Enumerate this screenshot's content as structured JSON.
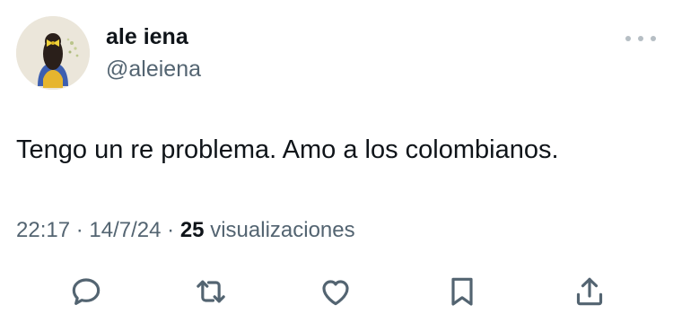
{
  "author": {
    "display_name": "ale iena",
    "handle": "@aleiena",
    "avatar_icon": "profile-photo-girl-with-yellow-bow"
  },
  "tweet": {
    "text": "Tengo un re problema. Amo a los colombianos."
  },
  "meta": {
    "time": "22:17",
    "date": "14/7/24",
    "separator": "·",
    "views_count": "25",
    "views_label": "visualizaciones"
  },
  "actions": [
    {
      "icon": "reply-icon"
    },
    {
      "icon": "repost-icon"
    },
    {
      "icon": "like-icon"
    },
    {
      "icon": "bookmark-icon"
    },
    {
      "icon": "share-icon"
    }
  ],
  "colors": {
    "primary_text": "#0f1419",
    "secondary_text": "#536471",
    "icon": "#536471",
    "background": "#ffffff"
  }
}
